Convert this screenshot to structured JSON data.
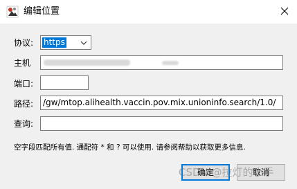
{
  "window": {
    "title": "编辑位置",
    "close_icon": "close-icon"
  },
  "form": {
    "protocol": {
      "label": "协议:",
      "selected": "https"
    },
    "host": {
      "label": "主机",
      "value": ""
    },
    "port": {
      "label": "端口:",
      "value": ""
    },
    "path": {
      "label": "路径:",
      "value": "/gw/mtop.alihealth.vaccin.pov.mix.unioninfo.search/1.0/"
    },
    "query": {
      "label": "查询:",
      "value": ""
    }
  },
  "hint": "空字段匹配所有值. 通配符 * 和 ? 可以使用. 请参阅帮助以获取更多信息.",
  "buttons": {
    "ok": "确定",
    "cancel": "取消"
  },
  "watermark": "CSDN @拉灯的小手",
  "colors": {
    "accent": "#0078d7",
    "dialog_bg": "#f0f0f0"
  }
}
